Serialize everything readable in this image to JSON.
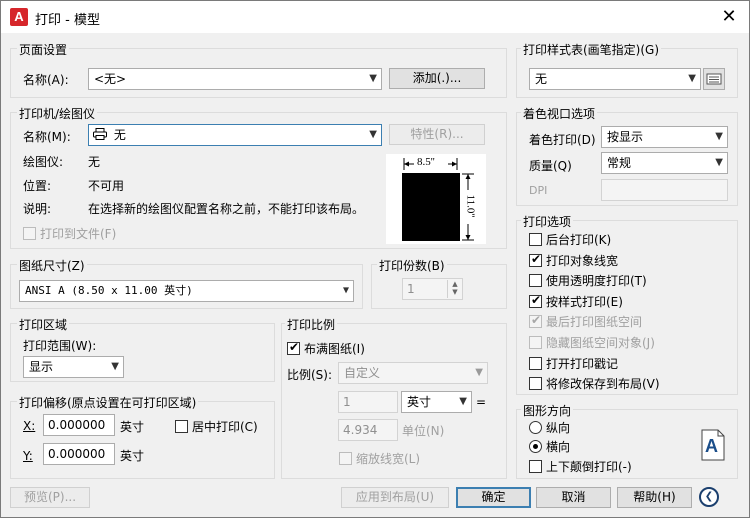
{
  "window": {
    "title": "打印 - 模型",
    "app_icon": "A",
    "close": "✕"
  },
  "page_setup": {
    "group_title": "页面设置",
    "name_label": "名称(A):",
    "name_value": "<无>",
    "add_button": "添加(.)..."
  },
  "printer": {
    "group_title": "打印机/绘图仪",
    "name_label": "名称(M):",
    "name_value": "无",
    "properties_button": "特性(R)...",
    "plotter_label": "绘图仪:",
    "plotter_value": "无",
    "location_label": "位置:",
    "location_value": "不可用",
    "description_label": "说明:",
    "description_value": "在选择新的绘图仪配置名称之前，不能打印该布局。",
    "print_to_file": "打印到文件(F)",
    "preview_width": "8.5''",
    "preview_height": "11.0''"
  },
  "paper_size": {
    "group_title": "图纸尺寸(Z)",
    "value": "ANSI A (8.50 x 11.00 英寸)"
  },
  "copies": {
    "group_title": "打印份数(B)",
    "value": "1"
  },
  "plot_area": {
    "group_title": "打印区域",
    "range_label": "打印范围(W):",
    "range_value": "显示"
  },
  "plot_offset": {
    "group_title": "打印偏移(原点设置在可打印区域)",
    "x_label": "X:",
    "x_value": "0.000000",
    "x_unit": "英寸",
    "y_label": "Y:",
    "y_value": "0.000000",
    "y_unit": "英寸",
    "center_plot": "居中打印(C)"
  },
  "plot_scale": {
    "group_title": "打印比例",
    "fit_to_paper": "布满图纸(I)",
    "fit_checked": true,
    "scale_label": "比例(S):",
    "scale_value": "自定义",
    "value1": "1",
    "unit_value": "英寸",
    "equals": "=",
    "value2": "4.934",
    "unit_label": "单位(N)",
    "scale_lineweights": "缩放线宽(L)"
  },
  "plot_style": {
    "group_title": "打印样式表(画笔指定)(G)",
    "value": "无"
  },
  "shaded_viewport": {
    "group_title": "着色视口选项",
    "shade_label": "着色打印(D)",
    "shade_value": "按显示",
    "quality_label": "质量(Q)",
    "quality_value": "常规",
    "dpi_label": "DPI"
  },
  "plot_options": {
    "group_title": "打印选项",
    "items": [
      {
        "label": "后台打印(K)",
        "checked": false,
        "disabled": false
      },
      {
        "label": "打印对象线宽",
        "checked": true,
        "disabled": false
      },
      {
        "label": "使用透明度打印(T)",
        "checked": false,
        "disabled": false
      },
      {
        "label": "按样式打印(E)",
        "checked": true,
        "disabled": false
      },
      {
        "label": "最后打印图纸空间",
        "checked": true,
        "disabled": true
      },
      {
        "label": "隐藏图纸空间对象(J)",
        "checked": false,
        "disabled": true
      },
      {
        "label": "打开打印戳记",
        "checked": false,
        "disabled": false
      },
      {
        "label": "将修改保存到布局(V)",
        "checked": false,
        "disabled": false
      }
    ]
  },
  "orientation": {
    "group_title": "图形方向",
    "portrait": "纵向",
    "landscape": "横向",
    "selected": "横向",
    "upside_down": "上下颠倒打印(-)",
    "icon_letter": "A"
  },
  "footer": {
    "preview": "预览(P)...",
    "apply_to_layout": "应用到布局(U)",
    "ok": "确定",
    "cancel": "取消",
    "help": "帮助(H)",
    "collapse": "❮"
  }
}
